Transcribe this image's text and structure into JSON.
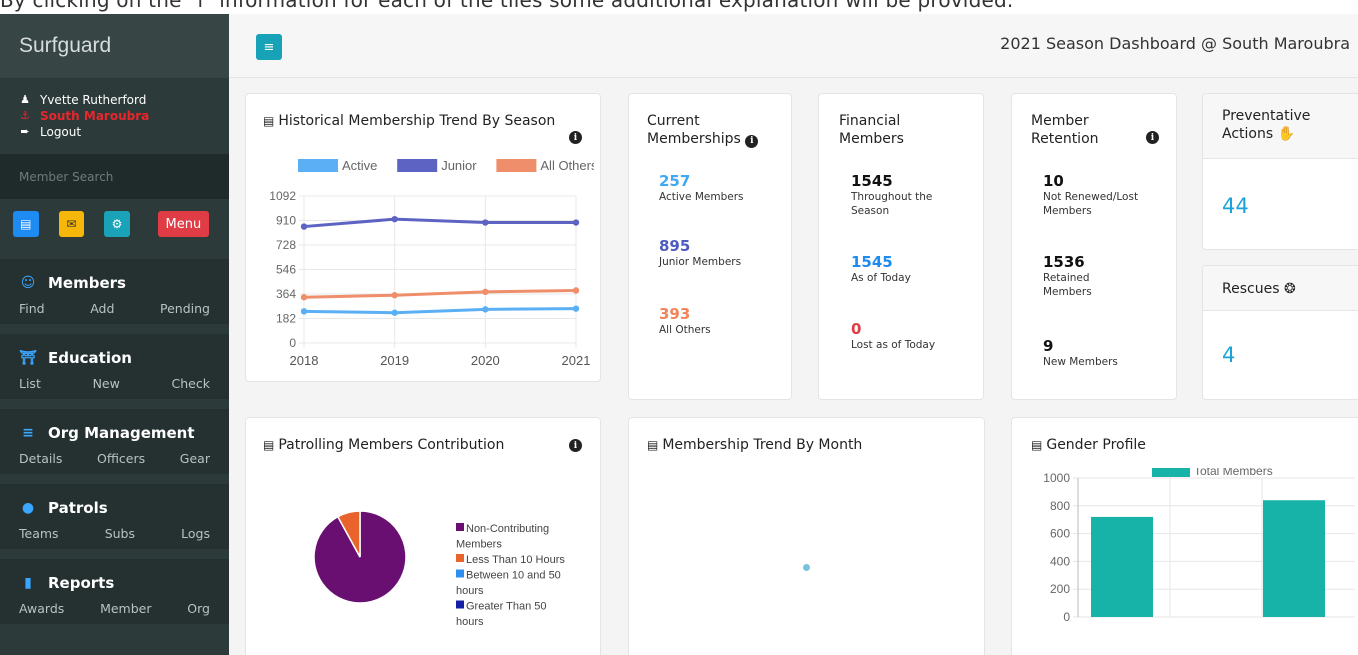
{
  "caption": "By clicking on the \"i\" information for each of the tiles some additional explanation will be provided.",
  "brand": "Surfguard",
  "user": {
    "name": "Yvette Rutherford",
    "club": "South Maroubra",
    "logout": "Logout"
  },
  "search": {
    "placeholder": "Member Search"
  },
  "quick_buttons": {
    "menu": "Menu"
  },
  "sidebar_sections": [
    {
      "title": "Members",
      "links": [
        "Find",
        "Add",
        "Pending"
      ]
    },
    {
      "title": "Education",
      "links": [
        "List",
        "New",
        "Check"
      ]
    },
    {
      "title": "Org Management",
      "links": [
        "Details",
        "Officers",
        "Gear"
      ]
    },
    {
      "title": "Patrols",
      "links": [
        "Teams",
        "Subs",
        "Logs"
      ]
    },
    {
      "title": "Reports",
      "links": [
        "Awards",
        "Member",
        "Org"
      ]
    }
  ],
  "header": {
    "title": "2021 Season Dashboard @ South Maroubra"
  },
  "cards": {
    "historical": {
      "title": "Historical Membership Trend By Season"
    },
    "current": {
      "title_line1": "Current",
      "title_line2": "Memberships",
      "stats": [
        {
          "num": "257",
          "label": "Active Members"
        },
        {
          "num": "895",
          "label": "Junior Members"
        },
        {
          "num": "393",
          "label": "All Others"
        }
      ]
    },
    "financial": {
      "title_line1": "Financial",
      "title_line2": "Members",
      "stats": [
        {
          "num": "1545",
          "label1": "Throughout the",
          "label2": "Season"
        },
        {
          "num": "1545",
          "label1": "As of Today",
          "label2": ""
        },
        {
          "num": "0",
          "label1": "Lost as of Today",
          "label2": ""
        }
      ]
    },
    "retention": {
      "title_line1": "Member",
      "title_line2": "Retention",
      "stats": [
        {
          "num": "10",
          "label1": "Not Renewed/Lost",
          "label2": "Members"
        },
        {
          "num": "1536",
          "label1": "Retained",
          "label2": "Members"
        },
        {
          "num": "9",
          "label1": "New Members",
          "label2": ""
        }
      ]
    },
    "preventative": {
      "title_line1": "Preventative",
      "title_line2": "Actions",
      "value": "44"
    },
    "rescues": {
      "title": "Rescues",
      "value": "4"
    },
    "patrolling": {
      "title": "Patrolling Members Contribution"
    },
    "monthly": {
      "title": "Membership Trend By Month"
    },
    "gender": {
      "title": "Gender Profile"
    }
  },
  "chart_data": [
    {
      "type": "line",
      "x": [
        "2018",
        "2019",
        "2020",
        "2021"
      ],
      "series": [
        {
          "name": "Active",
          "color": "#5bb0f5",
          "values": [
            235,
            225,
            250,
            255
          ]
        },
        {
          "name": "Junior",
          "color": "#5c63c2",
          "values": [
            865,
            920,
            895,
            895
          ]
        },
        {
          "name": "All Others",
          "color": "#ef8e6a",
          "values": [
            340,
            355,
            380,
            390
          ]
        }
      ],
      "yticks": [
        "0",
        "182",
        "364",
        "546",
        "728",
        "910",
        "1092"
      ],
      "ylim": [
        0,
        1092
      ]
    },
    {
      "type": "pie",
      "labels": [
        "Non-Contributing Members",
        "Less Than 10 Hours",
        "Between 10 and 50 hours",
        "Greater Than 50 hours"
      ],
      "legend": [
        [
          "Non-Contributing",
          "Members"
        ],
        [
          "Less Than 10 Hours"
        ],
        [
          "Between 10 and 50",
          "hours"
        ],
        [
          "Greater Than 50",
          "hours"
        ]
      ],
      "values": [
        92,
        8,
        0,
        0
      ],
      "colors": [
        "#6a0f72",
        "#e8642c",
        "#2f8ff0",
        "#1520a6"
      ]
    },
    {
      "type": "bar",
      "series": [
        {
          "name": "Total Members",
          "color": "#17b3a8",
          "values": [
            720,
            840
          ]
        }
      ],
      "yticks": [
        "0",
        "200",
        "400",
        "600",
        "800",
        "1000"
      ],
      "ylim": [
        0,
        1000
      ]
    }
  ]
}
